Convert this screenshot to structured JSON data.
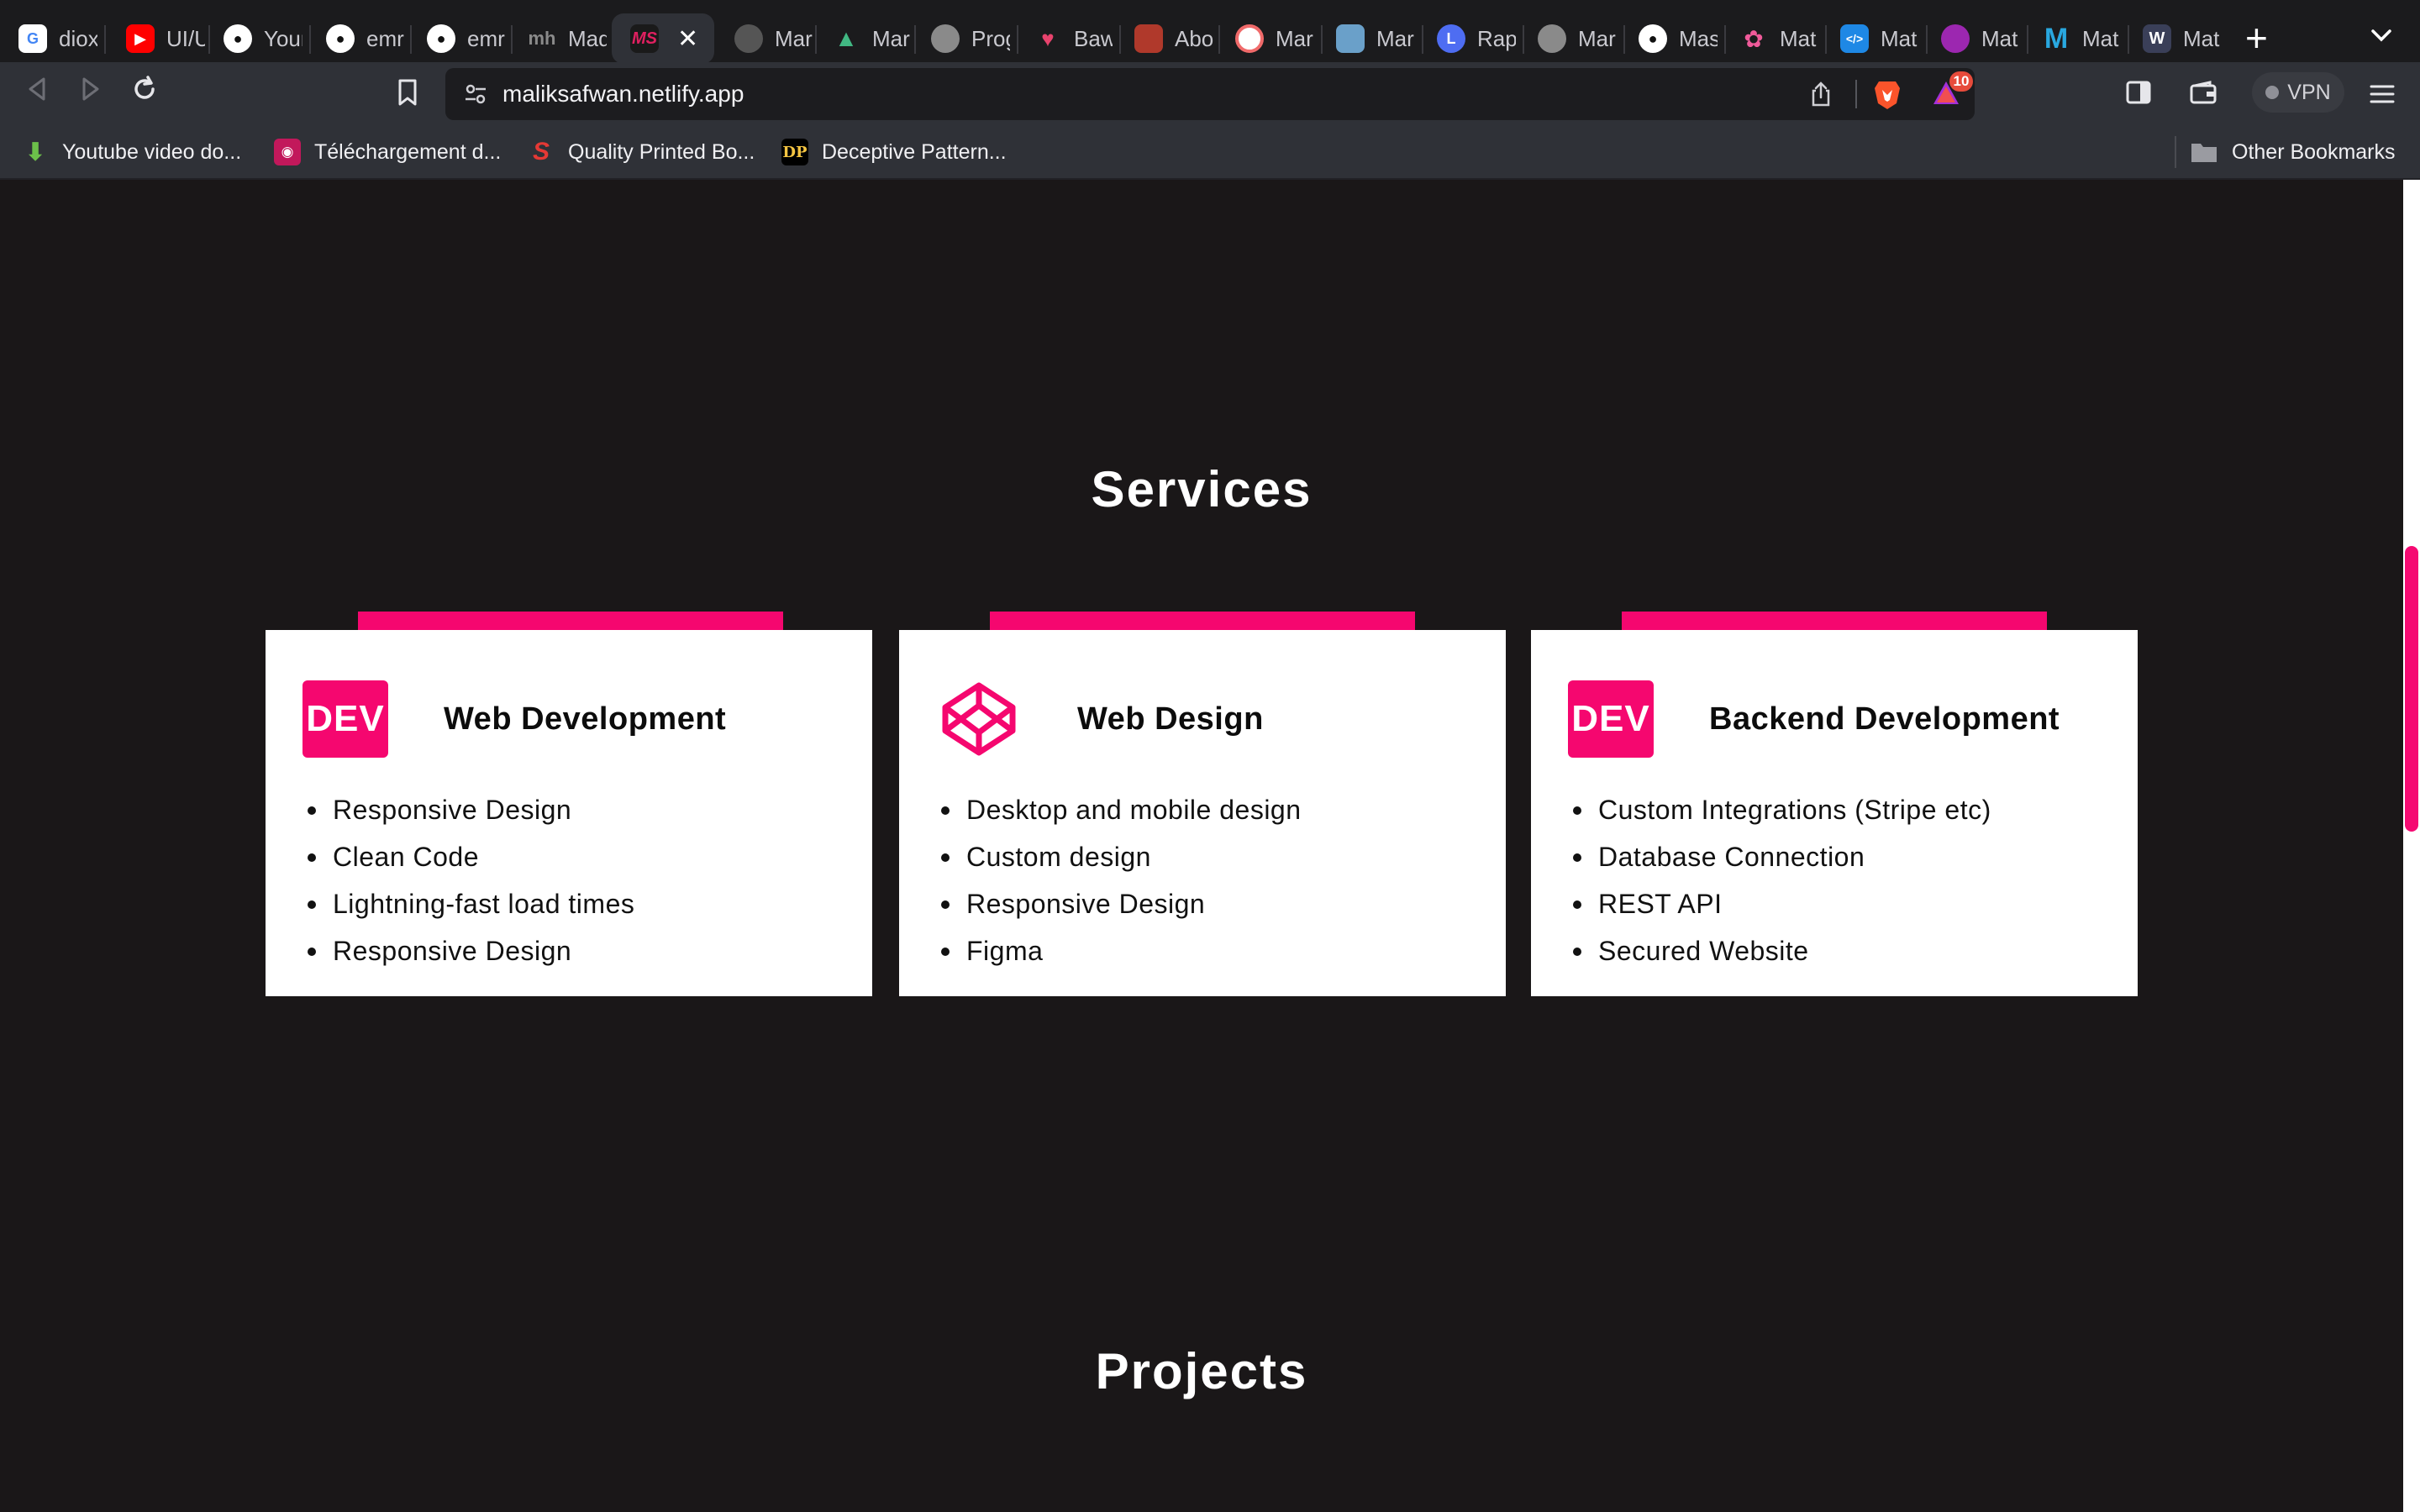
{
  "browser": {
    "tabs": [
      {
        "label": "diox",
        "icon": "google-icon",
        "color": "#ffffff"
      },
      {
        "label": "UI/U",
        "icon": "youtube-icon",
        "color": "#ff0000"
      },
      {
        "label": "Your",
        "icon": "github-icon",
        "color": "#ffffff"
      },
      {
        "label": "emr",
        "icon": "github-icon",
        "color": "#ffffff"
      },
      {
        "label": "emr",
        "icon": "github-icon",
        "color": "#ffffff"
      },
      {
        "label": "Mad",
        "icon": "mh-icon",
        "color": "#888888"
      },
      {
        "label": "",
        "icon": "ms-logo-icon",
        "color": "#e02060",
        "active": true
      },
      {
        "label": "Mar",
        "icon": "avatar-icon",
        "color": "#777777"
      },
      {
        "label": "Mar",
        "icon": "vue-icon",
        "color": "#41b883"
      },
      {
        "label": "Prog",
        "icon": "globe-icon",
        "color": "#9a9a9a"
      },
      {
        "label": "Baw",
        "icon": "bird-icon",
        "color": "#e8436d"
      },
      {
        "label": "Abo",
        "icon": "avatar-icon",
        "color": "#c0392b"
      },
      {
        "label": "Mar",
        "icon": "circle-logo-icon",
        "color": "#f06a6a"
      },
      {
        "label": "Mar",
        "icon": "avatar-icon",
        "color": "#6aa0c9"
      },
      {
        "label": "Rap",
        "icon": "l-logo-icon",
        "color": "#4e6df2"
      },
      {
        "label": "Mar",
        "icon": "globe-icon",
        "color": "#9a9a9a"
      },
      {
        "label": "Mas",
        "icon": "github-icon",
        "color": "#ffffff"
      },
      {
        "label": "Mat",
        "icon": "flower-icon",
        "color": "#f05a9a"
      },
      {
        "label": "Mat",
        "icon": "code-icon",
        "color": "#1e88e5"
      },
      {
        "label": "Mat",
        "icon": "circle-logo-icon",
        "color": "#9c27b0"
      },
      {
        "label": "Mat",
        "icon": "m-logo-icon",
        "color": "#29a8e0"
      },
      {
        "label": "Mat",
        "icon": "w-logo-icon",
        "color": "#3a3f58"
      }
    ],
    "active_tab_close": "✕",
    "new_tab": "+",
    "url": "maliksafwan.netlify.app",
    "rewards_badge": "10",
    "vpn_label": "VPN",
    "bookmarks": [
      {
        "label": "Youtube video do...",
        "icon": "download-arrow-icon",
        "color": "#5cb85c"
      },
      {
        "label": "Téléchargement d...",
        "icon": "app-icon",
        "color": "#c2185b"
      },
      {
        "label": "Quality Printed Bo...",
        "icon": "s-logo-icon",
        "color": "#e53935"
      },
      {
        "label": "Deceptive Pattern...",
        "icon": "dp-logo-icon",
        "color": "#000000"
      }
    ],
    "other_bookmarks": "Other Bookmarks"
  },
  "page": {
    "services_title": "Services",
    "projects_title": "Projects",
    "accent_color": "#f5076f",
    "cards": [
      {
        "logo": "DEV",
        "title": "Web Development",
        "items": [
          "Responsive Design",
          "Clean Code",
          "Lightning-fast load times",
          "Responsive Design"
        ]
      },
      {
        "logo": "codepen-icon",
        "title": "Web Design",
        "items": [
          "Desktop and mobile design",
          "Custom design",
          "Responsive Design",
          "Figma"
        ]
      },
      {
        "logo": "DEV",
        "title": "Backend Development",
        "items": [
          "Custom Integrations (Stripe etc)",
          "Database Connection",
          "REST API",
          "Secured Website"
        ]
      }
    ]
  }
}
